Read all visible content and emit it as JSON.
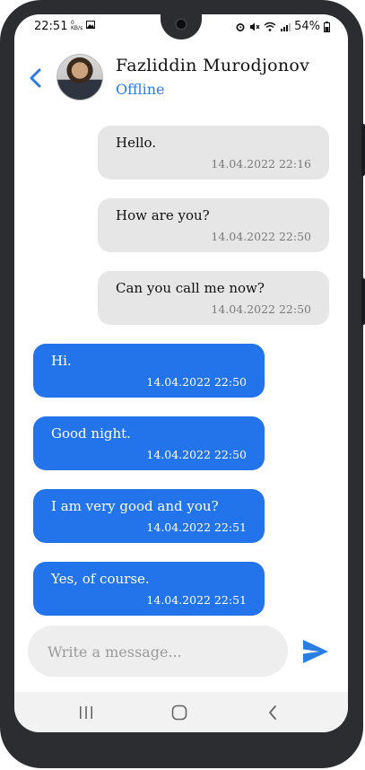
{
  "status_bar": {
    "time": "22:51",
    "speed": "0 KB/s",
    "battery": "54%"
  },
  "header": {
    "contact_name": "Fazliddin Murodjonov",
    "presence": "Offline"
  },
  "messages": [
    {
      "direction": "incoming",
      "text": "Hello.",
      "timestamp": "14.04.2022 22:16"
    },
    {
      "direction": "incoming",
      "text": "How are you?",
      "timestamp": "14.04.2022 22:50"
    },
    {
      "direction": "incoming",
      "text": "Can you call me now?",
      "timestamp": "14.04.2022 22:50"
    },
    {
      "direction": "outgoing",
      "text": "Hi.",
      "timestamp": "14.04.2022 22:50"
    },
    {
      "direction": "outgoing",
      "text": "Good night.",
      "timestamp": "14.04.2022 22:50"
    },
    {
      "direction": "outgoing",
      "text": "I am very good and you?",
      "timestamp": "14.04.2022 22:51"
    },
    {
      "direction": "outgoing",
      "text": "Yes, of course.",
      "timestamp": "14.04.2022 22:51"
    }
  ],
  "composer": {
    "placeholder": "Write a message..."
  },
  "colors": {
    "accent": "#2a7de1",
    "outgoing_bubble": "#2374eb",
    "incoming_bubble": "#e6e6e6"
  },
  "icons": {
    "back": "chevron-left-icon",
    "send": "send-icon",
    "nav_recents": "recents-icon",
    "nav_home": "home-icon",
    "nav_back": "nav-back-icon"
  }
}
